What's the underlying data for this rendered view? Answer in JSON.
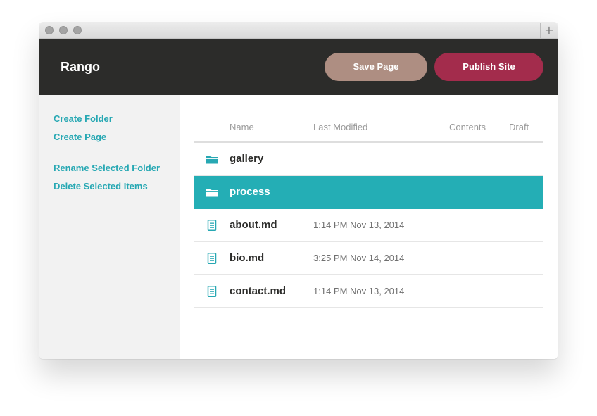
{
  "window": {
    "new_tab_glyph": "+"
  },
  "header": {
    "app_title": "Rango",
    "save_label": "Save Page",
    "publish_label": "Publish Site"
  },
  "sidebar": {
    "actions": [
      {
        "label": "Create Folder"
      },
      {
        "label": "Create Page"
      },
      {
        "label": "Rename Selected Folder"
      },
      {
        "label": "Delete Selected Items"
      }
    ]
  },
  "table": {
    "columns": [
      "Name",
      "Last Modified",
      "Contents",
      "Draft"
    ],
    "rows": [
      {
        "name": "gallery",
        "modified": "",
        "type": "folder-icon",
        "selected": false
      },
      {
        "name": "process",
        "modified": "",
        "type": "folder-icon",
        "selected": true
      },
      {
        "name": "about.md",
        "modified": "1:14 PM Nov 13, 2014",
        "type": "document-icon",
        "selected": false
      },
      {
        "name": "bio.md",
        "modified": "3:25 PM Nov 14, 2014",
        "type": "document-icon",
        "selected": false
      },
      {
        "name": "contact.md",
        "modified": "1:14 PM Nov 13, 2014",
        "type": "document-icon",
        "selected": false
      }
    ]
  },
  "colors": {
    "header_bg": "#2c2c2a",
    "save_button": "#ae8e82",
    "publish_button": "#a32c4c",
    "accent": "#27a8b3",
    "selected_row": "#24aeb5"
  }
}
